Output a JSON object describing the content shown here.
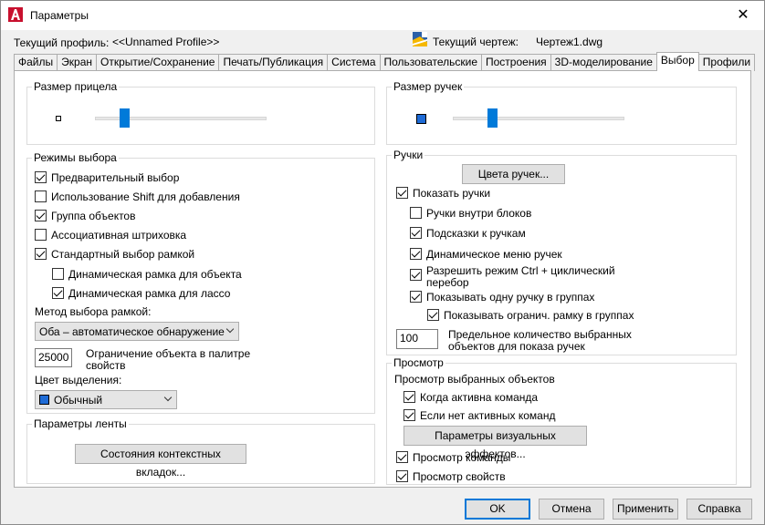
{
  "window": {
    "title": "Параметры",
    "close_glyph": "✕"
  },
  "header": {
    "profile_label": "Текущий профиль:",
    "profile_value": "<<Unnamed Profile>>",
    "drawing_label": "Текущий чертеж:",
    "drawing_value": "Чертеж1.dwg"
  },
  "tabs": [
    {
      "label": "Файлы",
      "active": false
    },
    {
      "label": "Экран",
      "active": false
    },
    {
      "label": "Открытие/Сохранение",
      "active": false
    },
    {
      "label": "Печать/Публикация",
      "active": false
    },
    {
      "label": "Система",
      "active": false
    },
    {
      "label": "Пользовательские",
      "active": false
    },
    {
      "label": "Построения",
      "active": false
    },
    {
      "label": "3D-моделирование",
      "active": false
    },
    {
      "label": "Выбор",
      "active": true
    },
    {
      "label": "Профили",
      "active": false
    }
  ],
  "pickbox": {
    "title": "Размер прицела",
    "slider_level": 0.17
  },
  "selection_modes": {
    "title": "Режимы выбора",
    "items": [
      {
        "label": "Предварительный выбор",
        "checked": true
      },
      {
        "label": "Использование Shift для добавления",
        "checked": false
      },
      {
        "label": "Группа объектов",
        "checked": true
      },
      {
        "label": "Ассоциативная штриховка",
        "checked": false
      },
      {
        "label": "Стандартный выбор рамкой",
        "checked": true
      },
      {
        "label": "Динамическая рамка для объекта",
        "checked": false
      },
      {
        "label": "Динамическая рамка для лассо",
        "checked": true
      }
    ],
    "method_label": "Метод выбора рамкой:",
    "method_value": "Оба – автоматическое обнаружение",
    "limit_value": "25000",
    "limit_label_1": "Ограничение объекта в палитре",
    "limit_label_2": "свойств",
    "color_label": "Цвет выделения:",
    "color_value": "Обычный",
    "color_hex": "#1e6bd6"
  },
  "ribbon": {
    "title": "Параметры ленты",
    "button": "Состояния контекстных вкладок..."
  },
  "grip_size": {
    "title": "Размер ручек",
    "slider_level": 0.2
  },
  "grips": {
    "title": "Ручки",
    "colors_button": "Цвета ручек...",
    "items": [
      {
        "label": "Показать ручки",
        "checked": true
      },
      {
        "label": "Ручки внутри блоков",
        "checked": false
      },
      {
        "label": "Подсказки к ручкам",
        "checked": true
      },
      {
        "label": "Динамическое меню ручек",
        "checked": true
      },
      {
        "label": "Разрешить режим Ctrl + циклический",
        "checked": true
      },
      {
        "label": "Показывать одну ручку в группах",
        "checked": true
      },
      {
        "label": "Показывать огранич. рамку в группах",
        "checked": true
      }
    ],
    "ctrl_label_2": "перебор",
    "limit_value": "100",
    "limit_label_1": "Предельное количество выбранных",
    "limit_label_2": "объектов для показа ручек"
  },
  "preview": {
    "title": "Просмотр",
    "subtitle": "Просмотр выбранных объектов",
    "items": [
      {
        "label": "Когда активна команда",
        "checked": true
      },
      {
        "label": "Если нет активных команд",
        "checked": true
      },
      {
        "label": "Просмотр команды",
        "checked": true
      },
      {
        "label": "Просмотр свойств",
        "checked": true
      }
    ],
    "visual_button": "Параметры визуальных эффектов..."
  },
  "footer": {
    "ok": "OK",
    "cancel": "Отмена",
    "apply": "Применить",
    "help": "Справка"
  },
  "colors": {
    "accent": "#0078d7",
    "slider_thumb": "#007ad9",
    "app_icon": "#c8102e"
  }
}
